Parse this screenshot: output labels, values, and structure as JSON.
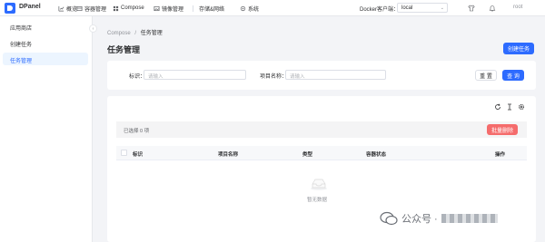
{
  "app": {
    "name": "DPanel"
  },
  "nav": [
    {
      "label": "概览",
      "icon": "chart-icon"
    },
    {
      "label": "容器管理",
      "icon": "container-icon"
    },
    {
      "label": "Compose",
      "icon": "compose-icon"
    },
    {
      "label": "镜像管理",
      "icon": "image-icon"
    },
    {
      "label": "存储&网络",
      "icon": "storage-icon"
    },
    {
      "label": "系统",
      "icon": "gear-icon"
    }
  ],
  "header": {
    "docker_label": "Docker客户端：",
    "docker_value": "local",
    "user": "root"
  },
  "sidebar": {
    "items": [
      {
        "label": "应用商店"
      },
      {
        "label": "创建任务"
      },
      {
        "label": "任务管理",
        "active": true
      }
    ]
  },
  "breadcrumb": {
    "parent": "Compose",
    "sep": "/",
    "current": "任务管理"
  },
  "page": {
    "title": "任务管理",
    "create_button": "创建任务"
  },
  "search": {
    "id_label": "标识：",
    "id_placeholder": "请输入",
    "name_label": "项目名称：",
    "name_placeholder": "请输入",
    "reset_button": "重 置",
    "search_button": "查 询"
  },
  "table": {
    "selected_text": "已选择  0  项",
    "batch_delete_button": "批量删除",
    "columns": [
      "标识",
      "项目名称",
      "类型",
      "容器状态",
      "操作"
    ],
    "empty_text": "暂无数据"
  },
  "watermark": {
    "text": "公众号 ·"
  },
  "colors": {
    "primary": "#2d6bff",
    "danger": "#f56c6c",
    "active_bg": "#ecf5ff"
  }
}
